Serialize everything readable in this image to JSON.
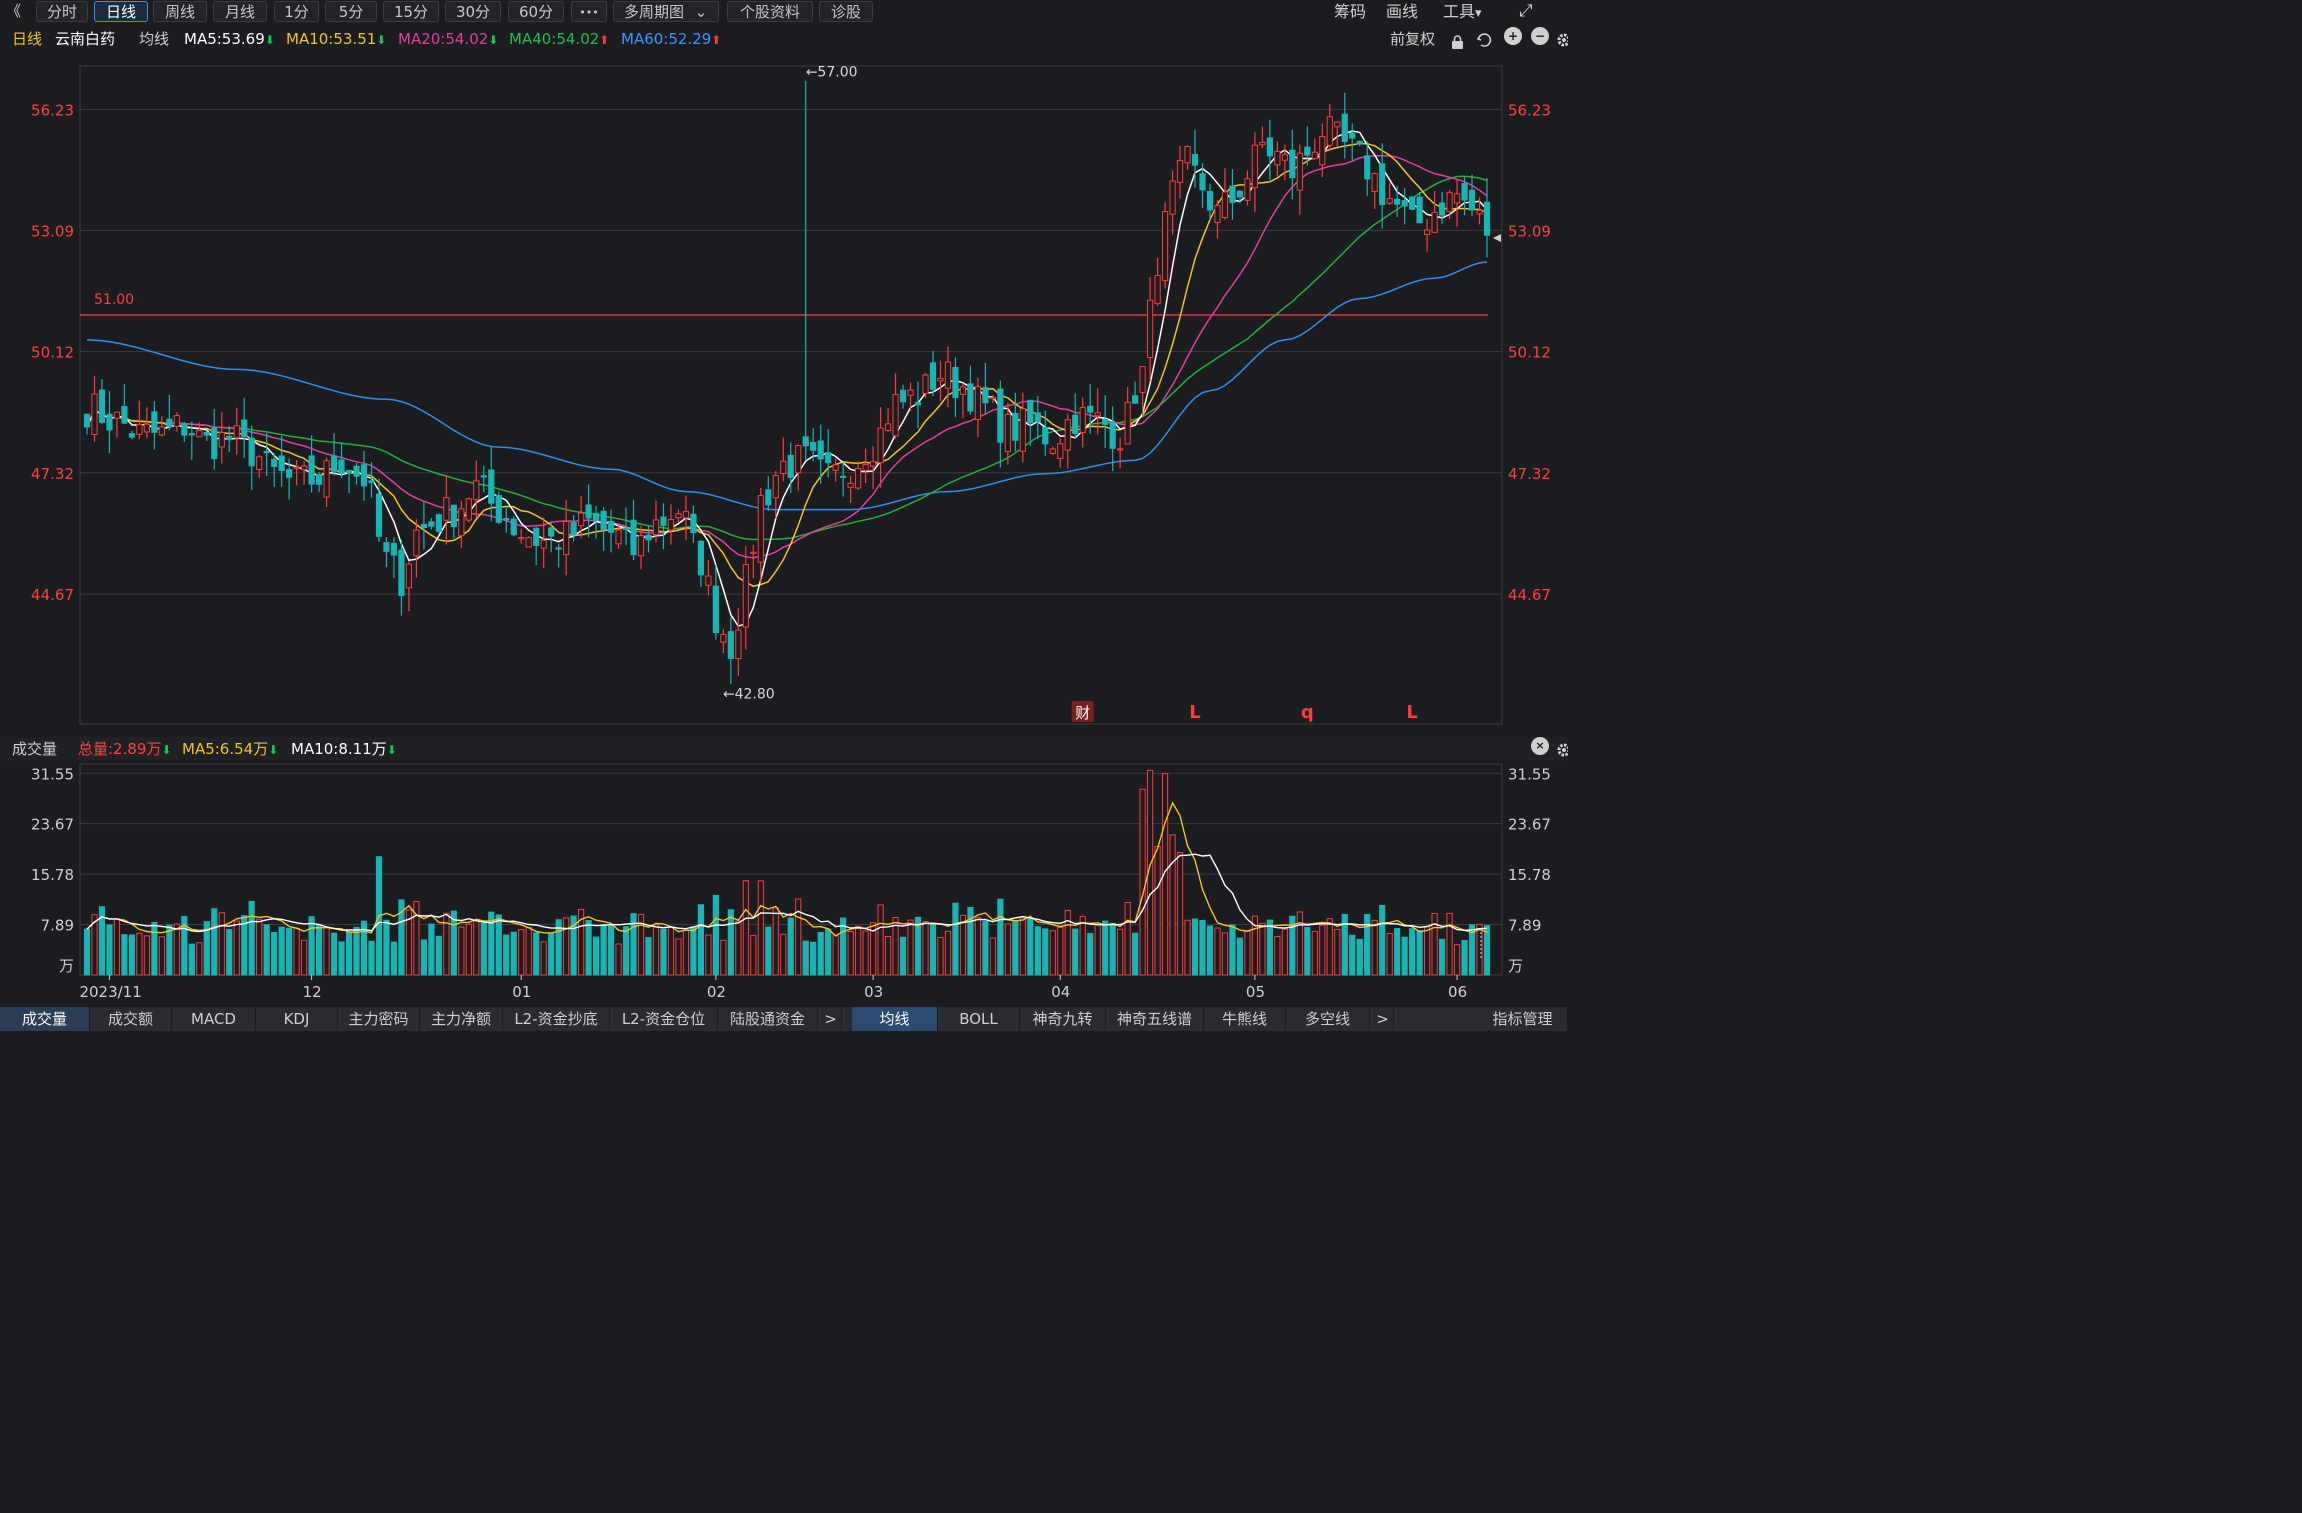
{
  "toolbar": {
    "back_glyph": "《",
    "periods": [
      "分时",
      "日线",
      "周线",
      "月线",
      "1分",
      "5分",
      "15分",
      "30分",
      "60分"
    ],
    "active_period": "日线",
    "more_glyph": "•••",
    "multi_chart": "多周期图",
    "multi_chart_arrow": "⌄",
    "stock_info": "个股资料",
    "diagnose": "诊股",
    "right": {
      "chips": "筹码",
      "draw": "画线",
      "tools": "工具",
      "tools_arrow": "▾",
      "expand_glyph": "⤢"
    }
  },
  "indicator_bar": {
    "period": "日线",
    "stock_name": "云南白药",
    "ma_label": "均线",
    "ma5": "MA5:53.69",
    "ma10": "MA10:53.51",
    "ma20": "MA20:54.02",
    "ma40": "MA40:54.02",
    "ma60": "MA60:52.29",
    "adjust": "前复权",
    "down_arrow": "⬇",
    "up_arrow": "⬆"
  },
  "colors": {
    "bg": "#1b1c20",
    "up": "#ff3b3b",
    "down": "#19b4b4",
    "ma5": "#ffffff",
    "ma10": "#f5c518",
    "ma20": "#e0409c",
    "ma40": "#20b040",
    "ma60": "#2f8fe8",
    "grid": "#3a3b40",
    "axis_text_price": "#ff4040",
    "axis_text_vol": "#d0d0d0",
    "hline": "#ff4040"
  },
  "price_axis_ticks": [
    "56.23",
    "53.09",
    "50.12",
    "47.32",
    "44.67"
  ],
  "annotations": {
    "high": "←57.00",
    "low": "←42.80",
    "hline_label": "51.00",
    "cai": "财",
    "marks": [
      "L",
      "q",
      "L"
    ]
  },
  "volume_header": {
    "label": "成交量",
    "total": "总量:2.89万",
    "ma5": "MA5:6.54万",
    "ma10": "MA10:8.11万",
    "down_arrow": "⬇"
  },
  "volume_axis_ticks": [
    "31.55",
    "23.67",
    "15.78",
    "7.89",
    "万"
  ],
  "x_axis_labels": [
    "2023/11",
    "12",
    "01",
    "02",
    "03",
    "04",
    "05",
    "06"
  ],
  "bottom_tabs_left": [
    "成交量",
    "成交额",
    "MACD",
    "KDJ",
    "主力密码",
    "主力净额",
    "L2-资金抄底",
    "L2-资金仓位",
    "陆股通资金"
  ],
  "bottom_tabs_right": [
    "均线",
    "BOLL",
    "神奇九转",
    "神奇五线谱",
    "牛熊线",
    "多空线"
  ],
  "bottom_arrow": ">",
  "indicator_manage": "指标管理",
  "chart_data": {
    "type": "candlestick",
    "title": "",
    "ylim": [
      42.0,
      57.4
    ],
    "yscale": "log",
    "volume_ylim": [
      0,
      33
    ],
    "volume_unit": "万",
    "hline": 51.0,
    "high_point": {
      "value": 57.0,
      "index": 96
    },
    "low_point": {
      "value": 42.8,
      "index": 86
    },
    "month_starts": {
      "2023/11": 0,
      "12": 2,
      "01": 6,
      "02": 10,
      "03": 14,
      "04": 17,
      "05": 20,
      "06": 23
    },
    "waypoints_close": [
      [
        0,
        48.8
      ],
      [
        4,
        48.5
      ],
      [
        7,
        48.2
      ],
      [
        10,
        48.2
      ],
      [
        13,
        48.4
      ],
      [
        16,
        48.0
      ],
      [
        19,
        48.1
      ],
      [
        22,
        47.8
      ],
      [
        25,
        47.3
      ],
      [
        28,
        47.1
      ],
      [
        31,
        47.2
      ],
      [
        34,
        47.6
      ],
      [
        37,
        47.2
      ],
      [
        40,
        45.4
      ],
      [
        42,
        45.0
      ],
      [
        44,
        46.0
      ],
      [
        46,
        46.2
      ],
      [
        49,
        46.5
      ],
      [
        52,
        47.0
      ],
      [
        55,
        46.5
      ],
      [
        58,
        46.0
      ],
      [
        61,
        45.8
      ],
      [
        64,
        45.9
      ],
      [
        67,
        46.2
      ],
      [
        70,
        46.0
      ],
      [
        73,
        45.6
      ],
      [
        76,
        46.2
      ],
      [
        79,
        46.5
      ],
      [
        82,
        45.4
      ],
      [
        84,
        44.2
      ],
      [
        86,
        43.6
      ],
      [
        88,
        44.9
      ],
      [
        90,
        46.7
      ],
      [
        93,
        47.5
      ],
      [
        96,
        47.6
      ],
      [
        99,
        47.2
      ],
      [
        102,
        47.5
      ],
      [
        105,
        48.0
      ],
      [
        108,
        48.9
      ],
      [
        111,
        49.1
      ],
      [
        114,
        49.6
      ],
      [
        117,
        49.3
      ],
      [
        120,
        48.8
      ],
      [
        123,
        48.3
      ],
      [
        126,
        48.4
      ],
      [
        129,
        48.1
      ],
      [
        132,
        48.6
      ],
      [
        135,
        48.5
      ],
      [
        138,
        48.2
      ],
      [
        141,
        49.6
      ],
      [
        143,
        52.4
      ],
      [
        145,
        54.0
      ],
      [
        147,
        54.8
      ],
      [
        149,
        54.2
      ],
      [
        151,
        53.5
      ],
      [
        153,
        53.9
      ],
      [
        155,
        54.5
      ],
      [
        157,
        55.3
      ],
      [
        159,
        55.0
      ],
      [
        161,
        54.6
      ],
      [
        163,
        55.1
      ],
      [
        165,
        55.7
      ],
      [
        167,
        55.4
      ],
      [
        169,
        55.1
      ],
      [
        171,
        54.7
      ],
      [
        173,
        54.1
      ],
      [
        175,
        53.7
      ],
      [
        177,
        53.2
      ],
      [
        179,
        53.4
      ],
      [
        181,
        53.8
      ],
      [
        183,
        54.0
      ],
      [
        185,
        53.6
      ],
      [
        187,
        53.1
      ]
    ],
    "waypoints_ma60": [
      [
        0,
        50.4
      ],
      [
        20,
        49.7
      ],
      [
        40,
        49.0
      ],
      [
        55,
        47.9
      ],
      [
        70,
        47.4
      ],
      [
        80,
        46.9
      ],
      [
        92,
        46.5
      ],
      [
        102,
        46.5
      ],
      [
        115,
        46.9
      ],
      [
        128,
        47.3
      ],
      [
        140,
        47.6
      ],
      [
        150,
        49.2
      ],
      [
        160,
        50.4
      ],
      [
        170,
        51.4
      ],
      [
        180,
        51.9
      ],
      [
        187,
        52.3
      ]
    ],
    "ma_periods": {
      "ma5": 5,
      "ma10": 10,
      "ma20": 20,
      "ma40": 40
    },
    "n_candles": 188
  }
}
